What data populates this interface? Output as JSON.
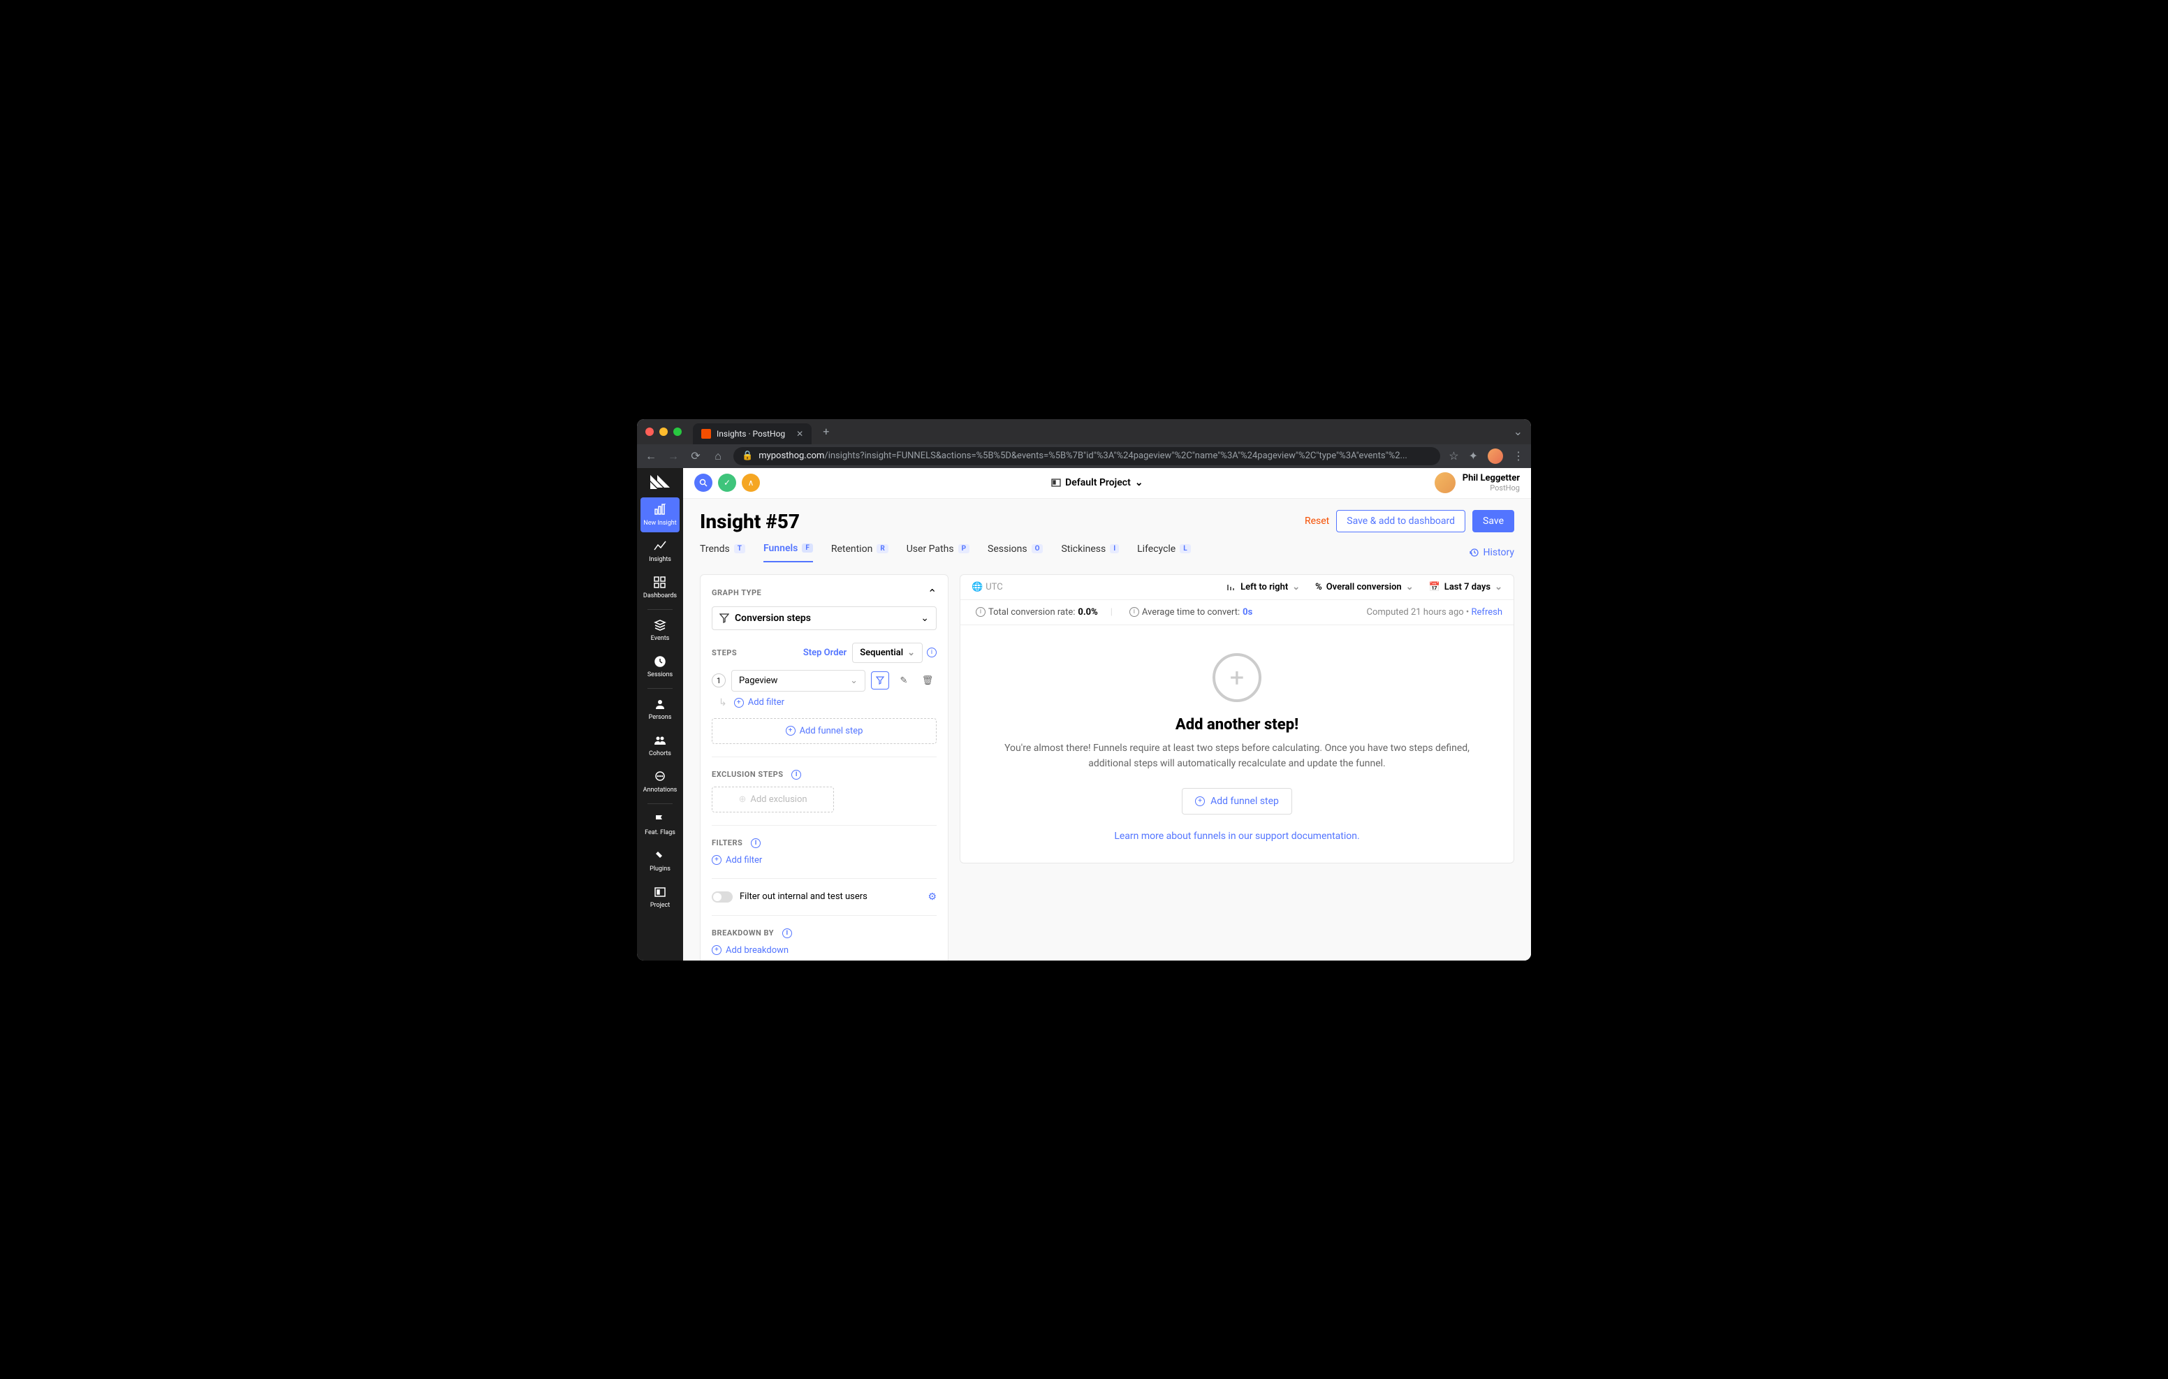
{
  "browser": {
    "tab_title": "Insights · PostHog",
    "url_host": "myposthog.com",
    "url_path": "/insights?insight=FUNNELS&actions=%5B%5D&events=%5B%7B\"id\"%3A\"%24pageview\"%2C\"name\"%3A\"%24pageview\"%2C\"type\"%3A\"events\"%2..."
  },
  "topbar": {
    "project": "Default Project",
    "user_name": "Phil Leggetter",
    "user_org": "PostHog"
  },
  "sidebar": {
    "items": [
      {
        "label": "New Insight"
      },
      {
        "label": "Insights"
      },
      {
        "label": "Dashboards"
      },
      {
        "label": "Events"
      },
      {
        "label": "Sessions"
      },
      {
        "label": "Persons"
      },
      {
        "label": "Cohorts"
      },
      {
        "label": "Annotations"
      },
      {
        "label": "Feat. Flags"
      },
      {
        "label": "Plugins"
      },
      {
        "label": "Project"
      }
    ]
  },
  "page": {
    "title": "Insight #57",
    "reset": "Reset",
    "save_dashboard": "Save & add to dashboard",
    "save": "Save",
    "history": "History"
  },
  "tabs": [
    {
      "label": "Trends",
      "key": "T"
    },
    {
      "label": "Funnels",
      "key": "F"
    },
    {
      "label": "Retention",
      "key": "R"
    },
    {
      "label": "User Paths",
      "key": "P"
    },
    {
      "label": "Sessions",
      "key": "O"
    },
    {
      "label": "Stickiness",
      "key": "I"
    },
    {
      "label": "Lifecycle",
      "key": "L"
    }
  ],
  "left_panel": {
    "graph_type_label": "GRAPH TYPE",
    "graph_type_value": "Conversion steps",
    "steps_label": "STEPS",
    "step_order_label": "Step Order",
    "step_order_value": "Sequential",
    "step1_event": "Pageview",
    "add_filter": "Add filter",
    "add_funnel_step": "Add funnel step",
    "exclusion_label": "EXCLUSION STEPS",
    "add_exclusion": "Add exclusion",
    "filters_label": "FILTERS",
    "filter_internal": "Filter out internal and test users",
    "breakdown_label": "BREAKDOWN BY",
    "add_breakdown": "Add breakdown"
  },
  "right_panel": {
    "utc": "UTC",
    "direction": "Left to right",
    "conversion": "Overall conversion",
    "daterange": "Last 7 days",
    "total_label": "Total conversion rate:",
    "total_value": "0.0%",
    "avg_label": "Average time to convert:",
    "avg_value": "0s",
    "computed": "Computed 21 hours ago",
    "refresh": "Refresh",
    "empty_title": "Add another step!",
    "empty_desc": "You're almost there! Funnels require at least two steps before calculating. Once you have two steps defined, additional steps will automatically recalculate and update the funnel.",
    "empty_btn": "Add funnel step",
    "empty_link": "Learn more about funnels in our support documentation."
  }
}
